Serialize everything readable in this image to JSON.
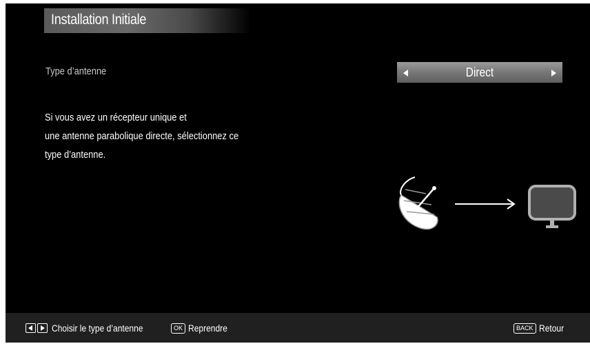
{
  "header": {
    "title": "Installation Initiale"
  },
  "antenna": {
    "label": "Type d’antenne",
    "value": "Direct"
  },
  "description": {
    "lines": [
      "Si vous avez un récepteur unique et",
      "une antenne parabolique directe, sélectionnez ce",
      "type d’antenne."
    ]
  },
  "footer": {
    "left_hint": "Choisir le type d’antenne",
    "ok_key": "OK",
    "ok_label": "Reprendre",
    "back_key": "BACK",
    "back_label": "Retour"
  },
  "illustration": {
    "icons": [
      "satellite-dish-icon",
      "arrow-right-icon",
      "tv-icon"
    ]
  },
  "colors": {
    "background": "#000000",
    "footer": "#202020",
    "selector": "#7b7b7b",
    "text": "#ffffff",
    "muted_text": "#c9c9c9"
  }
}
